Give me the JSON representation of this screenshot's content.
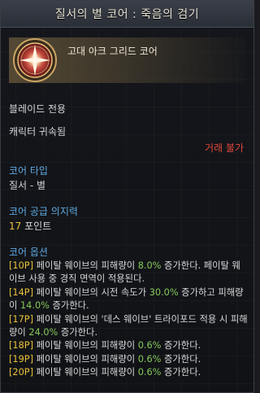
{
  "title": "질서의 별 코어 : 죽음의 검기",
  "grade": "고대 아크 그리드 코어",
  "lines": {
    "blade_only": "블레이드 전용",
    "char_bound": "캐릭터 귀속됨",
    "untradable": "거래 불가"
  },
  "core_type": {
    "label": "코어 타입",
    "value": "질서 - 별"
  },
  "core_supply": {
    "label": "코어 공급 의지력",
    "value_num": "17",
    "value_unit": " 포인트"
  },
  "options_title": "코어 옵션",
  "options": [
    {
      "tag": "[10P]",
      "pre": " 페이탈 웨이브의 피해량이 ",
      "val": "8.0%",
      "post": " 증가한다. 페이탈 웨이브 사용 중 경직 면역이 적용된다."
    },
    {
      "tag": "[14P]",
      "pre": " 페이탈 웨이브의 시전 속도가 ",
      "val": "30.0%",
      "mid": " 증가하고 피해량이 ",
      "val2": "14.0%",
      "post": " 증가한다."
    },
    {
      "tag": "[17P]",
      "pre": " 페이탈 웨이브의 '데스 웨이브' 트라이포드 적용 시 피해량이 ",
      "val": "24.0%",
      "post": " 증가한다."
    },
    {
      "tag": "[18P]",
      "pre": " 페이탈 웨이브의 피해량이 ",
      "val": "0.6%",
      "post": " 증가한다."
    },
    {
      "tag": "[19P]",
      "pre": " 페이탈 웨이브의 피해량이 ",
      "val": "0.6%",
      "post": " 증가한다."
    },
    {
      "tag": "[20P]",
      "pre": " 페이탈 웨이브의 피해량이 ",
      "val": "0.6%",
      "post": " 증가한다."
    }
  ]
}
